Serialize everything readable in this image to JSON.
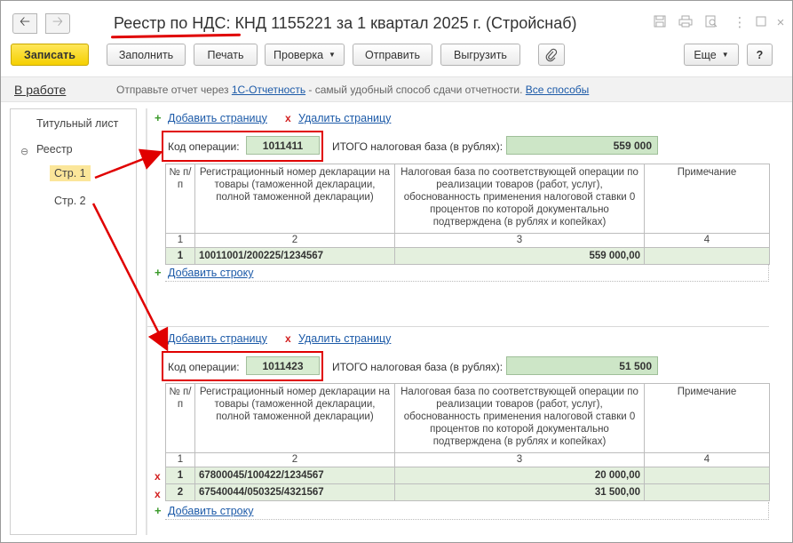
{
  "window": {
    "title": "Реестр по НДС: КНД 1155221 за 1 квартал 2025 г. (Стройснаб)",
    "back_icon": "arrow-left-icon",
    "forward_icon": "arrow-right-icon"
  },
  "toolbar": {
    "save": "Записать",
    "fill": "Заполнить",
    "print": "Печать",
    "check": "Проверка",
    "send": "Отправить",
    "upload": "Выгрузить",
    "more": "Еще",
    "help": "?",
    "attach_icon": "paperclip-icon"
  },
  "infobar": {
    "status": "В работе",
    "text_before": "Отправьте отчет через ",
    "link1": "1С-Отчетность",
    "text_middle": " - самый удобный способ сдачи отчетности. ",
    "link2": "Все способы"
  },
  "sidebar": {
    "title_sheet": "Титульный лист",
    "registry": "Реестр",
    "page1": "Стр. 1",
    "page2": "Стр. 2"
  },
  "labels": {
    "add_page": "Добавить страницу",
    "delete_page": "Удалить страницу",
    "op_code": "Код операции:",
    "total_base": "ИТОГО налоговая база (в рублях):",
    "add_row": "Добавить строку"
  },
  "columns": {
    "num": "№ п/п",
    "reg": "Регистрационный номер декларации на товары (таможенной декларации, полной таможенной декларации)",
    "base": "Налоговая база по соответствующей операции по реализации товаров (работ, услуг), обоснованность применения налоговой ставки 0 процентов по которой документально подтверждена (в рублях и копейках)",
    "note": "Примечание",
    "idx": [
      "1",
      "2",
      "3",
      "4"
    ]
  },
  "page1": {
    "op_code": "1011411",
    "total": "559 000",
    "rows": [
      {
        "num": "1",
        "reg": "10011001/200225/1234567",
        "base": "559 000,00",
        "note": ""
      }
    ]
  },
  "page2": {
    "op_code": "1011423",
    "total": "51 500",
    "rows": [
      {
        "num": "1",
        "reg": "67800045/100422/1234567",
        "base": "20 000,00",
        "note": ""
      },
      {
        "num": "2",
        "reg": "67540044/050325/4321567",
        "base": "31 500,00",
        "note": ""
      }
    ]
  },
  "colors": {
    "accent_yellow": "#f5d000",
    "green_field": "#d7ecd1",
    "link": "#1c5aa8",
    "highlight_red": "#e00000"
  }
}
